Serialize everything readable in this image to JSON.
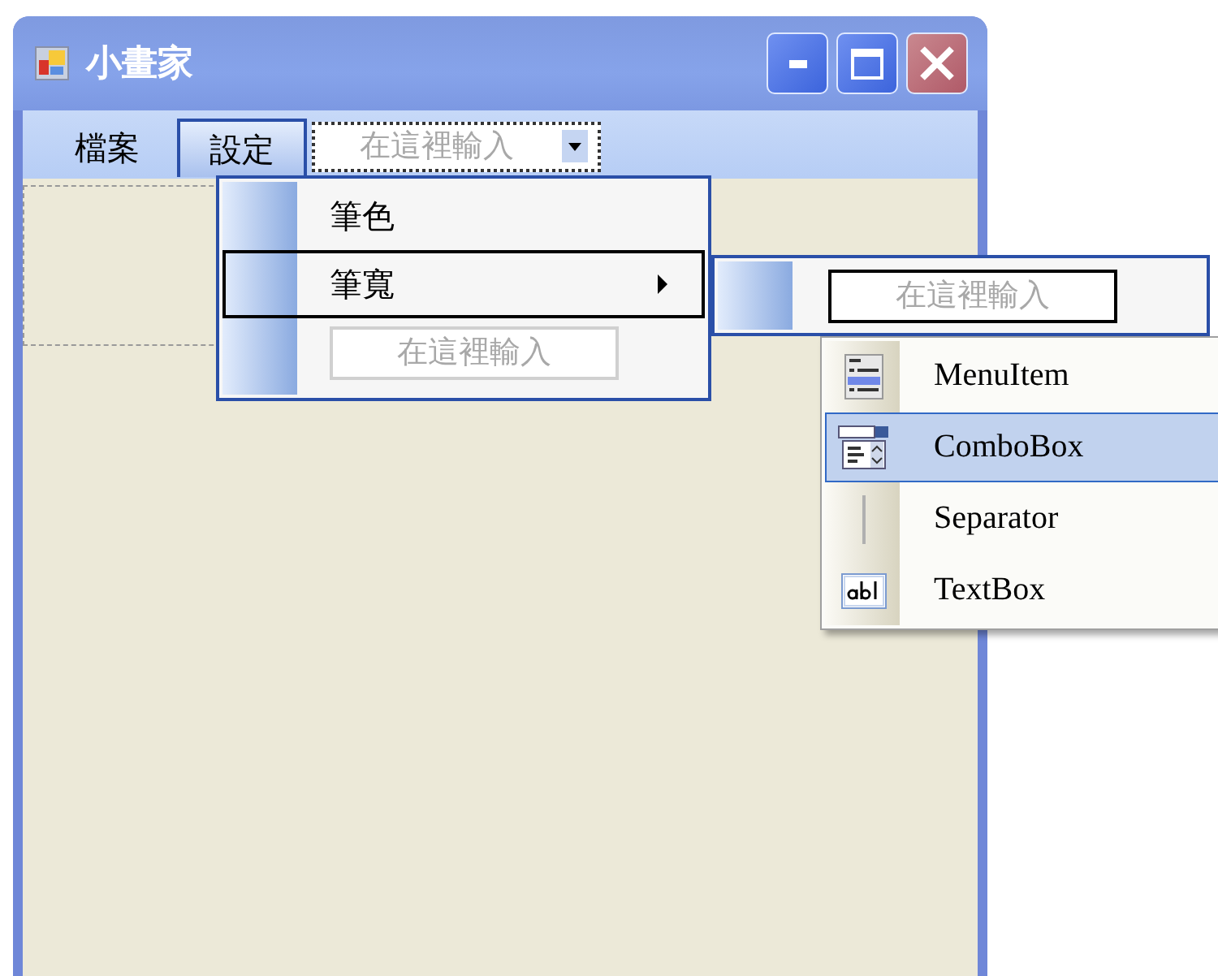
{
  "window": {
    "title": "小畫家"
  },
  "menu_bar": {
    "items": [
      {
        "label": "檔案",
        "selected": false
      },
      {
        "label": "設定",
        "selected": true
      }
    ],
    "new_item_combo": {
      "placeholder": "在這裡輸入"
    }
  },
  "dropdown_menu": {
    "items": [
      {
        "kind": "item",
        "label": "筆色",
        "selected": false,
        "has_submenu": false
      },
      {
        "kind": "item",
        "label": "筆寬",
        "selected": true,
        "has_submenu": true
      },
      {
        "kind": "textbox",
        "placeholder": "在這裡輸入"
      }
    ]
  },
  "submenu": {
    "items": [
      {
        "kind": "textbox",
        "placeholder": "在這裡輸入",
        "selected": true
      }
    ]
  },
  "type_picker": {
    "items": [
      {
        "kind": "menuitem",
        "label": "MenuItem",
        "selected": false
      },
      {
        "kind": "combobox",
        "label": "ComboBox",
        "selected": true
      },
      {
        "kind": "separator",
        "label": "Separator",
        "selected": false
      },
      {
        "kind": "textbox",
        "label": "TextBox",
        "selected": false
      }
    ]
  }
}
